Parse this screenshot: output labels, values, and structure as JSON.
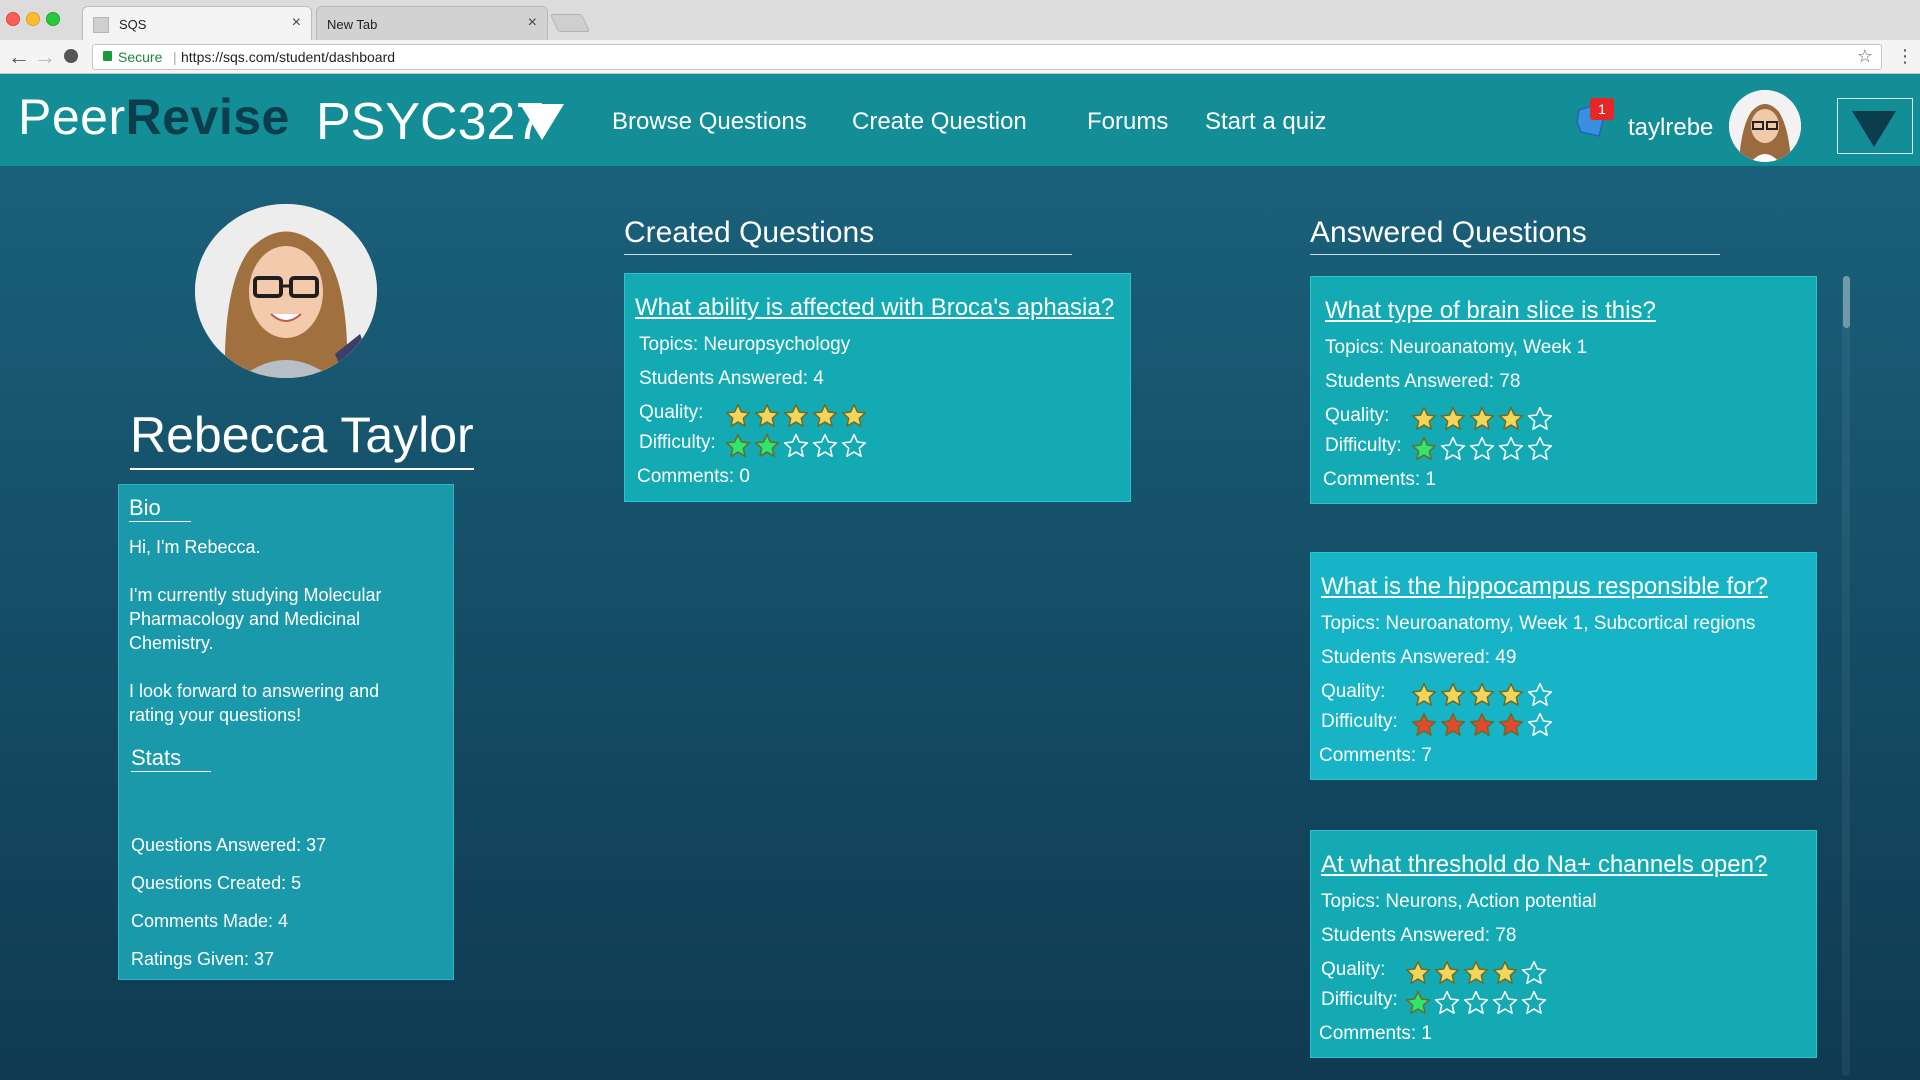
{
  "browser": {
    "tabs": [
      {
        "title": "SQS",
        "active": true
      },
      {
        "title": "New Tab",
        "active": false
      }
    ],
    "secure_label": "Secure",
    "url": "https://sqs.com/student/dashboard"
  },
  "header": {
    "logo_part1": "Peer",
    "logo_part2": "Revise",
    "course": "PSYC327",
    "nav": [
      "Browse Questions",
      "Create Question",
      "Forums",
      "Start a quiz"
    ],
    "notification_count": "1",
    "username": "taylrebe"
  },
  "profile": {
    "name": "Rebecca Taylor",
    "bio_heading": "Bio",
    "bio": [
      "Hi, I'm Rebecca.",
      "I'm currently studying Molecular Pharmacology and Medicinal Chemistry.",
      "I look forward to answering and rating your questions!"
    ],
    "stats_heading": "Stats",
    "stats": [
      "Questions Answered: 37",
      "Questions Created: 5",
      "Comments Made: 4",
      "Ratings Given: 37"
    ]
  },
  "labels": {
    "quality": "Quality:",
    "difficulty": "Difficulty:"
  },
  "colors": {
    "star_quality": "#f3d55b",
    "star_easy": "#2ee86b",
    "star_hard": "#e04a2f"
  },
  "created": {
    "heading": "Created Questions",
    "questions": [
      {
        "title": "What ability is affected with Broca's aphasia?",
        "topics": "Topics: Neuropsychology",
        "answered": "Students Answered: 4",
        "quality": 5,
        "difficulty": 2,
        "difficulty_color": "star_easy",
        "comments": "Comments: 0"
      }
    ]
  },
  "answered": {
    "heading": "Answered Questions",
    "questions": [
      {
        "title": "What type of brain slice is this?",
        "topics": "Topics: Neuroanatomy, Week 1",
        "answered": "Students Answered: 78",
        "quality": 4,
        "difficulty": 1,
        "difficulty_color": "star_easy",
        "comments": "Comments: 1"
      },
      {
        "title": "What is the hippocampus responsible for?",
        "topics": "Topics: Neuroanatomy, Week 1, Subcortical regions",
        "answered": "Students Answered: 49",
        "quality": 4,
        "difficulty": 4,
        "difficulty_color": "star_hard",
        "comments": "Comments: 7"
      },
      {
        "title": "At what threshold do Na+ channels open?",
        "topics": "Topics: Neurons, Action potential",
        "answered": "Students Answered: 78",
        "quality": 4,
        "difficulty": 1,
        "difficulty_color": "star_easy",
        "comments": "Comments: 1"
      }
    ]
  }
}
